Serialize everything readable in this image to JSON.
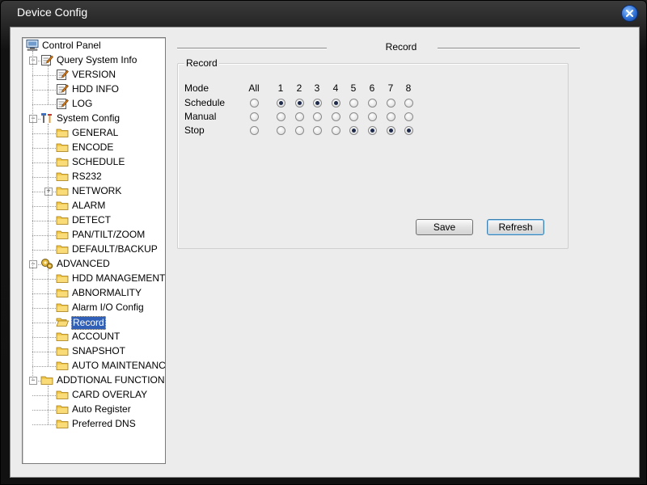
{
  "window": {
    "title": "Device Config"
  },
  "tree": [
    {
      "label": "Control Panel",
      "icon": "computer-icon",
      "level": 0
    },
    {
      "label": "Query System Info",
      "icon": "note-icon",
      "level": 1,
      "expander": "−"
    },
    {
      "label": "VERSION",
      "icon": "note-icon",
      "level": 2
    },
    {
      "label": "HDD INFO",
      "icon": "note-icon",
      "level": 2
    },
    {
      "label": "LOG",
      "icon": "note-icon",
      "level": 2
    },
    {
      "label": "System Config",
      "icon": "tools-icon",
      "level": 1,
      "expander": "−"
    },
    {
      "label": "GENERAL",
      "icon": "folder-icon",
      "level": 2
    },
    {
      "label": "ENCODE",
      "icon": "folder-icon",
      "level": 2
    },
    {
      "label": "SCHEDULE",
      "icon": "folder-icon",
      "level": 2
    },
    {
      "label": "RS232",
      "icon": "folder-icon",
      "level": 2
    },
    {
      "label": "NETWORK",
      "icon": "folder-icon",
      "level": 2,
      "expander": "+"
    },
    {
      "label": "ALARM",
      "icon": "folder-icon",
      "level": 2
    },
    {
      "label": "DETECT",
      "icon": "folder-icon",
      "level": 2
    },
    {
      "label": "PAN/TILT/ZOOM",
      "icon": "folder-icon",
      "level": 2
    },
    {
      "label": "DEFAULT/BACKUP",
      "icon": "folder-icon",
      "level": 2
    },
    {
      "label": "ADVANCED",
      "icon": "gears-icon",
      "level": 1,
      "expander": "−"
    },
    {
      "label": "HDD MANAGEMENT",
      "icon": "folder-icon",
      "level": 2
    },
    {
      "label": "ABNORMALITY",
      "icon": "folder-icon",
      "level": 2
    },
    {
      "label": "Alarm I/O Config",
      "icon": "folder-icon",
      "level": 2
    },
    {
      "label": "Record",
      "icon": "folder-open-icon",
      "level": 2,
      "selected": true
    },
    {
      "label": "ACCOUNT",
      "icon": "folder-icon",
      "level": 2
    },
    {
      "label": "SNAPSHOT",
      "icon": "folder-icon",
      "level": 2
    },
    {
      "label": "AUTO MAINTENANC",
      "icon": "folder-icon",
      "level": 2
    },
    {
      "label": "ADDTIONAL FUNCTION",
      "icon": "folder-icon",
      "level": 1,
      "expander": "−"
    },
    {
      "label": "CARD OVERLAY",
      "icon": "folder-icon",
      "level": 2
    },
    {
      "label": "Auto Register",
      "icon": "folder-icon",
      "level": 2
    },
    {
      "label": "Preferred DNS",
      "icon": "folder-icon",
      "level": 2
    }
  ],
  "main": {
    "title": "Record",
    "group": {
      "title": "Record",
      "mode_label": "Mode",
      "columns": [
        "All",
        "1",
        "2",
        "3",
        "4",
        "5",
        "6",
        "7",
        "8"
      ],
      "rows": [
        {
          "label": "Schedule",
          "checked": [
            false,
            true,
            true,
            true,
            true,
            false,
            false,
            false,
            false
          ]
        },
        {
          "label": "Manual",
          "checked": [
            false,
            false,
            false,
            false,
            false,
            false,
            false,
            false,
            false
          ]
        },
        {
          "label": "Stop",
          "checked": [
            false,
            false,
            false,
            false,
            false,
            true,
            true,
            true,
            true
          ]
        }
      ]
    },
    "buttons": {
      "save": "Save",
      "refresh": "Refresh"
    }
  }
}
